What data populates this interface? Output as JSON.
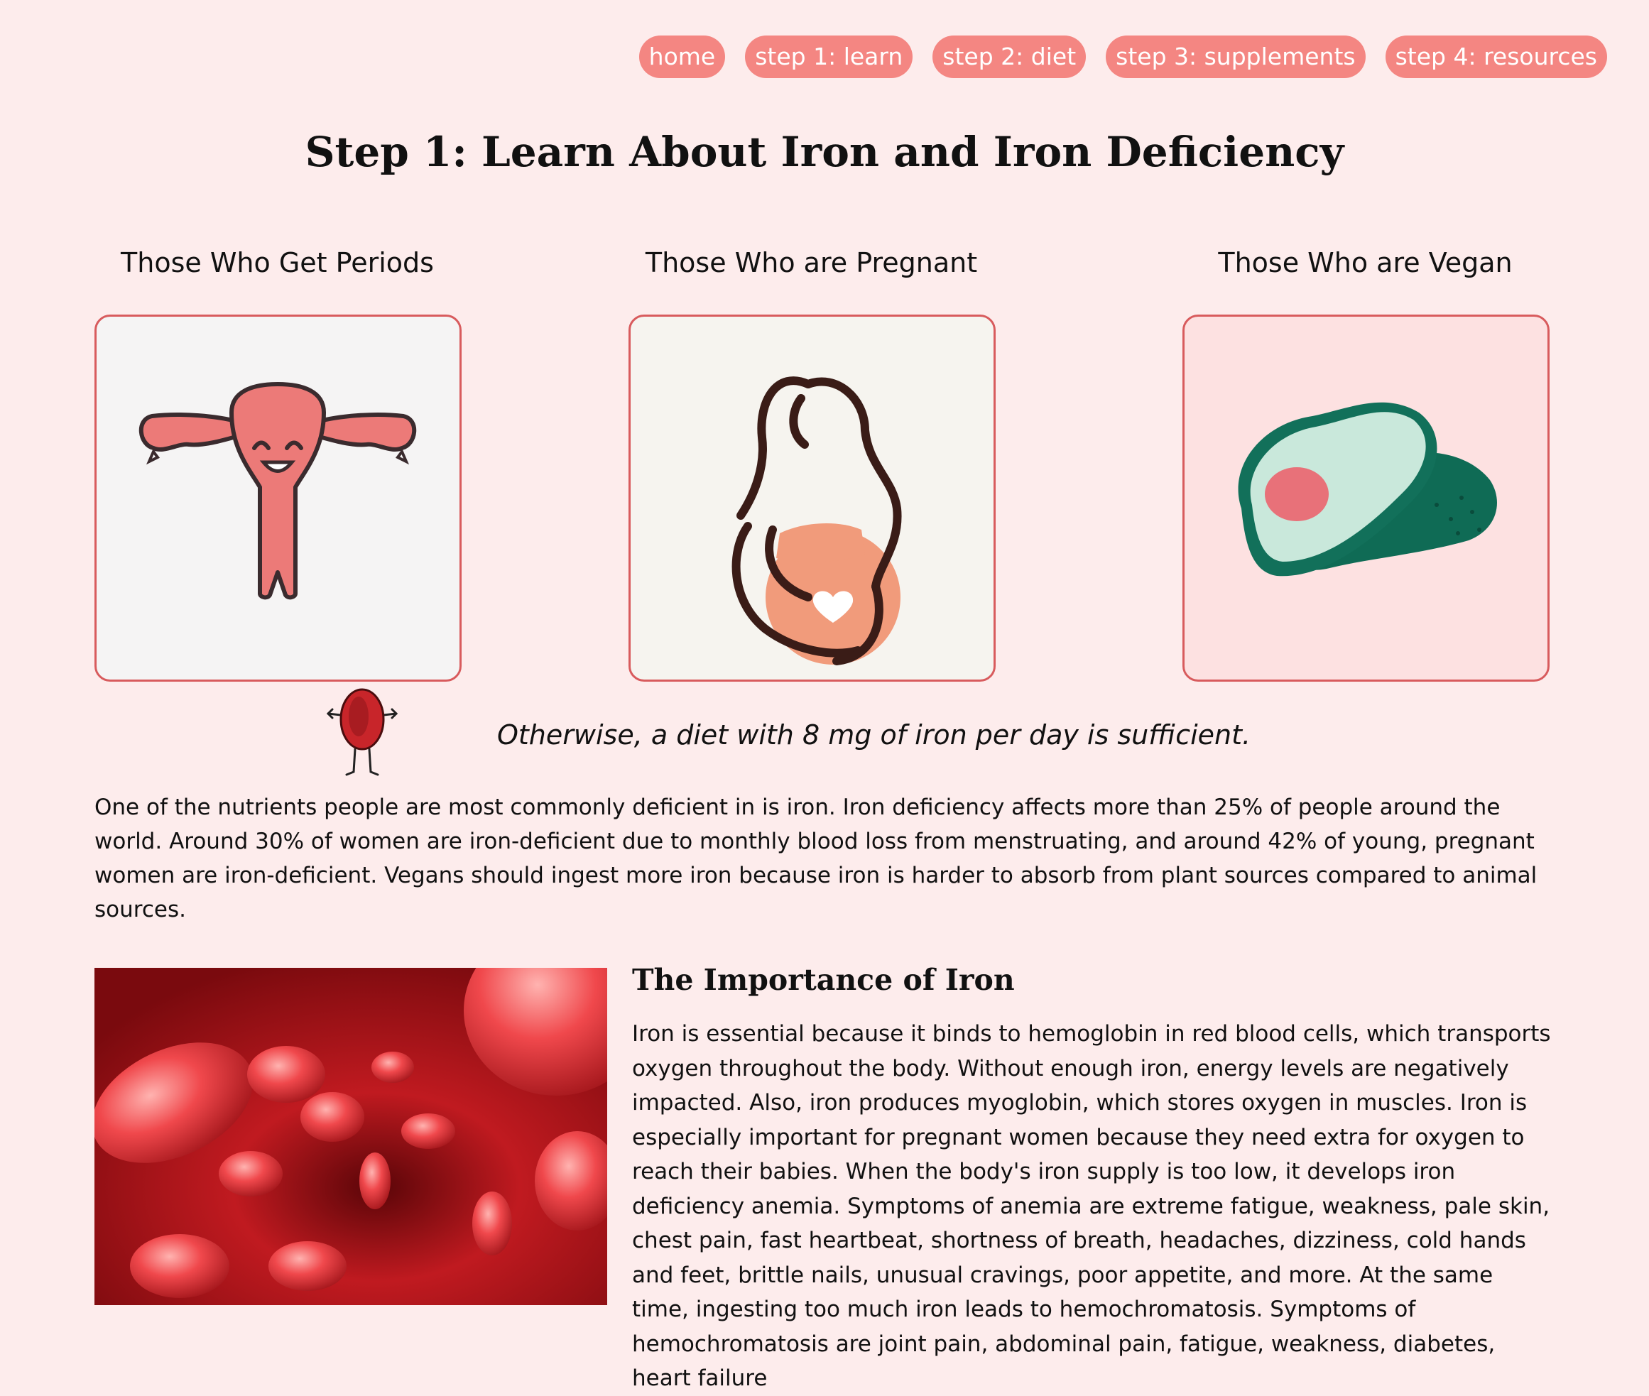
{
  "nav": {
    "items": [
      {
        "label": "home"
      },
      {
        "label": "step 1: learn"
      },
      {
        "label": "step 2: diet"
      },
      {
        "label": "step 3: supplements"
      },
      {
        "label": "step 4: resources"
      }
    ]
  },
  "page": {
    "title": "Step 1: Learn About Iron and Iron Deficiency"
  },
  "cards": [
    {
      "label": "Those Who Get Periods",
      "icon": "uterus-illustration"
    },
    {
      "label": "Those Who are Pregnant",
      "icon": "pregnant-woman-illustration"
    },
    {
      "label": "Those Who are Vegan",
      "icon": "avocado-illustration"
    }
  ],
  "note": {
    "text": "Otherwise, a diet with 8 mg of iron per day is sufficient.",
    "icon": "blood-cell-mascot"
  },
  "intro": {
    "text": "One of the nutrients people are most commonly deficient in is iron. Iron deficiency affects more than 25% of people around the world. Around 30% of women are iron-deficient due to monthly blood loss from menstruating, and around 42% of young, pregnant women are iron-deficient. Vegans should ingest more iron because iron is harder to absorb from plant sources compared to animal sources."
  },
  "importance": {
    "title": "The Importance of Iron",
    "body": "Iron is essential because it binds to hemoglobin in red blood cells, which transports oxygen throughout the body. Without enough iron, energy levels are negatively impacted. Also, iron produces myoglobin, which stores oxygen in muscles. Iron is especially important for pregnant women because they need extra for oxygen to reach their babies. When the body's iron supply is too low, it develops iron deficiency anemia. Symptoms of anemia are extreme fatigue, weakness, pale skin, chest pain, fast heartbeat, shortness of breath, headaches, dizziness, cold hands and feet, brittle nails, unusual cravings, poor appetite, and more. At the same time, ingesting too much iron leads to hemochromatosis. Symptoms of hemochromatosis are joint pain, abdominal pain, fatigue, weakness, diabetes, heart failure",
    "image": "red-blood-cells-photo"
  },
  "colors": {
    "background": "#fdecec",
    "nav_pill": "#f48682",
    "card_border": "#d85b5d",
    "accent_red": "#c8252a"
  }
}
